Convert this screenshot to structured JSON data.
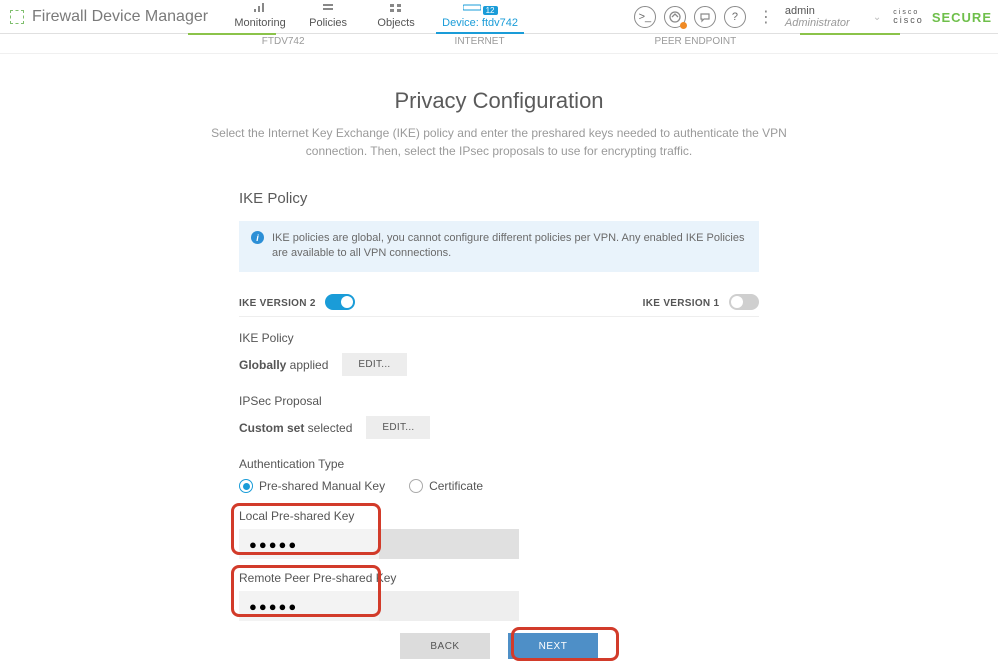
{
  "brand": {
    "title": "Firewall Device Manager"
  },
  "nav": {
    "monitoring": "Monitoring",
    "policies": "Policies",
    "objects": "Objects",
    "device_prefix": "Device:",
    "device_name": "ftdv742",
    "device_badge": "12"
  },
  "topright": {
    "user_name": "admin",
    "user_role": "Administrator",
    "cisco": "cisco",
    "secure": "SECURE"
  },
  "steps": {
    "a": "FTDV742",
    "b": "INTERNET",
    "c": "PEER ENDPOINT"
  },
  "page": {
    "title": "Privacy Configuration",
    "subtitle": "Select the Internet Key Exchange (IKE) policy and enter the preshared keys needed to authenticate the VPN connection. Then, select the IPsec proposals to use for encrypting traffic."
  },
  "panel": {
    "heading": "IKE Policy",
    "info": "IKE policies are global, you cannot configure different policies per VPN. Any enabled IKE Policies are available to all VPN connections.",
    "v2_label": "IKE VERSION 2",
    "v1_label": "IKE VERSION 1",
    "ike_policy_label": "IKE Policy",
    "globally": "Globally",
    "applied": " applied",
    "edit": "EDIT...",
    "ipsec_label": "IPSec Proposal",
    "custom": "Custom set",
    "selected": " selected",
    "auth_label": "Authentication Type",
    "radio_psk": "Pre-shared Manual Key",
    "radio_cert": "Certificate",
    "local_key_label": "Local Pre-shared Key",
    "local_key_value": "●●●●●",
    "remote_key_label": "Remote Peer Pre-shared Key",
    "remote_key_value": "●●●●●"
  },
  "buttons": {
    "back": "BACK",
    "next": "NEXT"
  }
}
